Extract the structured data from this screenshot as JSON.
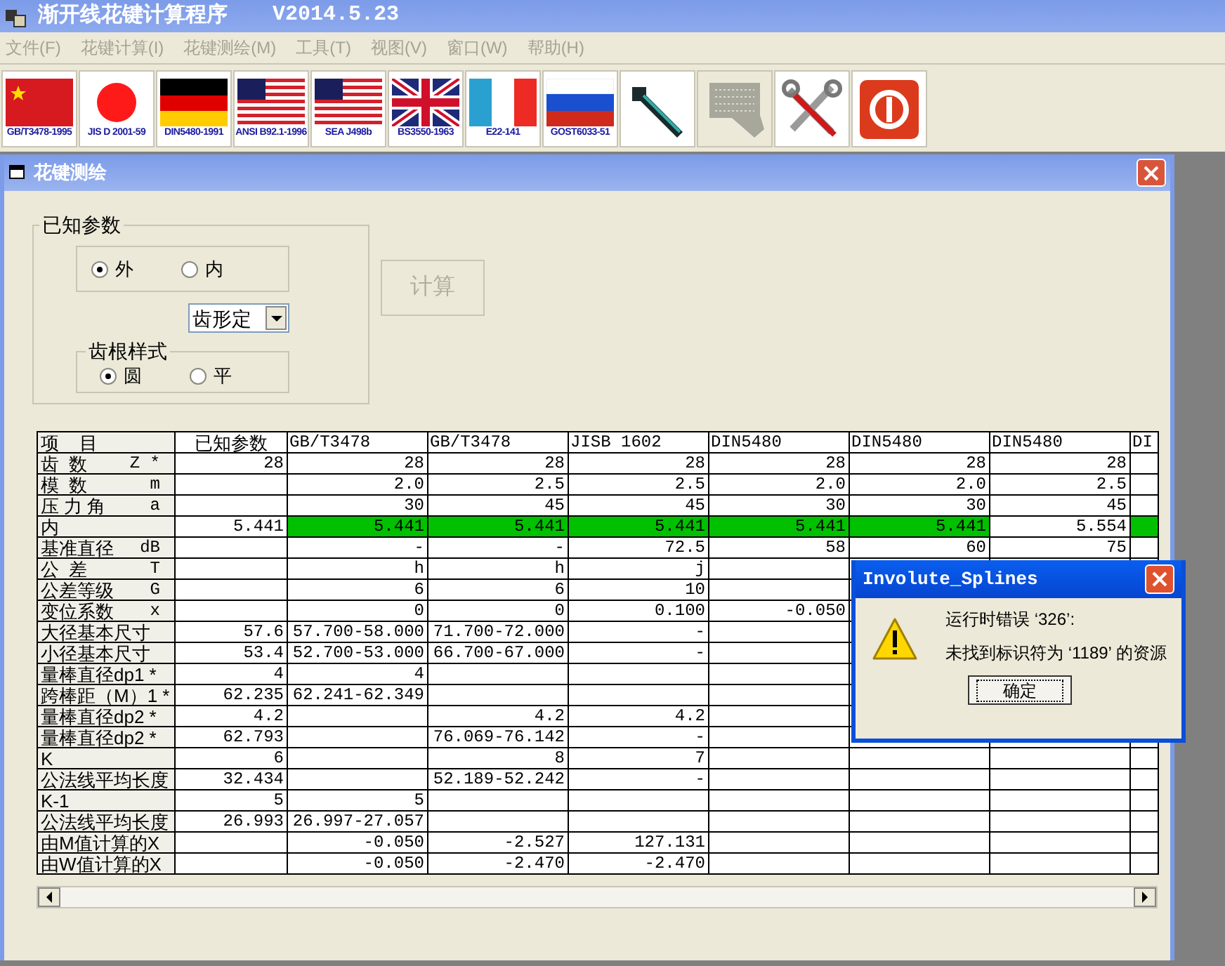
{
  "window": {
    "title": "渐开线花键计算程序",
    "version": "V2014.5.23"
  },
  "menu": [
    {
      "label": "文件(F)",
      "disabled": true
    },
    {
      "label": "花键计算(I)",
      "disabled": true
    },
    {
      "label": "花键测绘(M)",
      "disabled": true
    },
    {
      "label": "工具(T)",
      "disabled": true
    },
    {
      "label": "视图(V)",
      "disabled": true
    },
    {
      "label": "窗口(W)",
      "disabled": true
    },
    {
      "label": "帮助(H)",
      "disabled": true
    }
  ],
  "toolbar": [
    {
      "kind": "china",
      "caption": "GB/T3478-1995",
      "disabled": false
    },
    {
      "kind": "japan",
      "caption": "JIS D 2001-59",
      "disabled": false
    },
    {
      "kind": "germany",
      "caption": "DIN5480-1991",
      "disabled": false
    },
    {
      "kind": "usa",
      "caption": "ANSI B92.1-1996",
      "disabled": false
    },
    {
      "kind": "usa",
      "caption": "SEA J498b",
      "disabled": false
    },
    {
      "kind": "uk",
      "caption": "BS3550-1963",
      "disabled": false
    },
    {
      "kind": "france",
      "caption": "E22-141",
      "disabled": false
    },
    {
      "kind": "russia",
      "caption": "GOST6033-51",
      "disabled": false
    },
    {
      "kind": "caliper",
      "disabled": false
    },
    {
      "kind": "grid",
      "disabled": true
    },
    {
      "kind": "tools",
      "disabled": false
    },
    {
      "kind": "power",
      "disabled": false
    }
  ],
  "child_window": {
    "title": "花键测绘"
  },
  "known_params": {
    "title": "已知参数",
    "side_options": [
      {
        "label": "外",
        "selected": true
      },
      {
        "label": "内",
        "selected": false
      }
    ],
    "centering_select": {
      "value": "齿形定"
    },
    "root_style": {
      "title": "齿根样式",
      "options": [
        {
          "label": "圆",
          "selected": true
        },
        {
          "label": "平",
          "selected": false
        }
      ]
    }
  },
  "calc_button": {
    "label": "计算",
    "disabled": true
  },
  "table": {
    "label_header": "项    目",
    "columns": [
      "已知参数",
      "GB/T3478",
      "GB/T3478",
      "JISB 1602",
      "DIN5480",
      "DIN5480",
      "DIN5480",
      "DI"
    ],
    "rows": [
      {
        "label": "齿  数",
        "symbol": "Z *",
        "cells": [
          "28",
          "28",
          "28",
          "28",
          "28",
          "28",
          "28",
          ""
        ]
      },
      {
        "label": "模  数",
        "symbol": "m",
        "cells": [
          "",
          "2.0",
          "2.5",
          "2.5",
          "2.0",
          "2.0",
          "2.5",
          ""
        ]
      },
      {
        "label": "压 力 角",
        "symbol": "a",
        "cells": [
          "",
          "30",
          "45",
          "45",
          "30",
          "30",
          "45",
          ""
        ]
      },
      {
        "label": "内",
        "cells": [
          "5.441",
          "5.441",
          "5.441",
          "5.441",
          "5.441",
          "5.441",
          "5.554",
          ""
        ],
        "highlight": [
          false,
          true,
          true,
          true,
          true,
          true,
          false,
          true
        ]
      },
      {
        "label": "基准直径",
        "symbol": "dB",
        "cells": [
          "",
          "-",
          "-",
          "72.5",
          "58",
          "60",
          "75",
          ""
        ]
      },
      {
        "label": "公  差",
        "symbol": "T",
        "cells": [
          "",
          "h",
          "h",
          "j",
          "",
          "",
          "",
          ""
        ]
      },
      {
        "label": "公差等级",
        "symbol": "G",
        "cells": [
          "",
          "6",
          "6",
          "10",
          "",
          "",
          "",
          ""
        ]
      },
      {
        "label": "变位系数",
        "symbol": "x",
        "cells": [
          "",
          "0",
          "0",
          "0.100",
          "-0.050",
          "",
          "",
          ""
        ]
      },
      {
        "label": "大径基本尺寸",
        "cells": [
          "57.6",
          "57.700-58.000",
          "71.700-72.000",
          "-",
          "",
          "",
          "",
          ""
        ]
      },
      {
        "label": "小径基本尺寸",
        "cells": [
          "53.4",
          "52.700-53.000",
          "66.700-67.000",
          "-",
          "",
          "",
          "",
          ""
        ]
      },
      {
        "label": "量棒直径dp1 *",
        "cells": [
          "4",
          "4",
          "",
          "",
          "",
          "",
          "",
          ""
        ]
      },
      {
        "label": "跨棒距（M）1 *",
        "cells": [
          "62.235",
          "62.241-62.349",
          "",
          "",
          "",
          "",
          "",
          ""
        ]
      },
      {
        "label": "量棒直径dp2 *",
        "cells": [
          "4.2",
          "",
          "4.2",
          "4.2",
          "",
          "",
          "",
          ""
        ]
      },
      {
        "label": "量棒直径dp2 *",
        "cells": [
          "62.793",
          "",
          "76.069-76.142",
          "-",
          "",
          "",
          "",
          ""
        ]
      },
      {
        "label": "K",
        "cells": [
          "6",
          "",
          "8",
          "7",
          "",
          "",
          "",
          ""
        ]
      },
      {
        "label": "公法线平均长度",
        "cells": [
          "32.434",
          "",
          "52.189-52.242",
          "-",
          "",
          "",
          "",
          ""
        ]
      },
      {
        "label": "K-1",
        "cells": [
          "5",
          "5",
          "",
          "",
          "",
          "",
          "",
          ""
        ]
      },
      {
        "label": "公法线平均长度",
        "cells": [
          "26.993",
          "26.997-27.057",
          "",
          "",
          "",
          "",
          "",
          ""
        ]
      },
      {
        "label": "由M值计算的X",
        "cells": [
          "",
          "-0.050",
          "-2.527",
          "127.131",
          "",
          "",
          "",
          ""
        ]
      },
      {
        "label": "由W值计算的X",
        "cells": [
          "",
          "-0.050",
          "-2.470",
          "-2.470",
          "",
          "",
          "",
          ""
        ]
      }
    ]
  },
  "dialog": {
    "title": "Involute_Splines",
    "lines": [
      "运行时错误 ‘326’:",
      "未找到标识符为 ‘1189’ 的资源"
    ],
    "button": "确定"
  }
}
